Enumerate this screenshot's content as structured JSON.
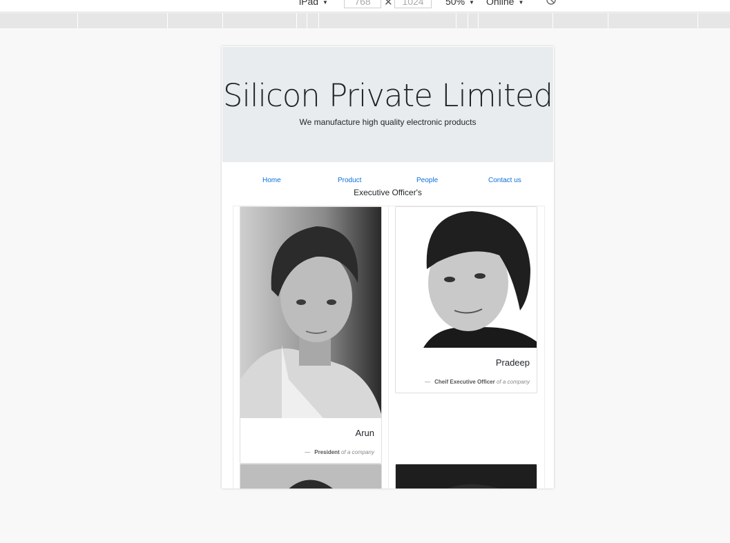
{
  "devtools": {
    "device": "iPad",
    "width": "768",
    "height": "1024",
    "zoom": "50%",
    "network": "Online"
  },
  "site": {
    "title": "Silicon Private Limited",
    "subtitle": "We manufacture high quality electronic products"
  },
  "nav": {
    "items": [
      "Home",
      "Product",
      "People",
      "Contact us"
    ]
  },
  "section": {
    "title": "Executive Officer's"
  },
  "cards": [
    {
      "name": "Arun",
      "role": "President",
      "org": "of a company"
    },
    {
      "name": "Pradeep",
      "role": "Cheif Executive Officer",
      "org": "of a company"
    }
  ],
  "colors": {
    "link": "#0b6fd8",
    "jumbotron": "#e9ecef"
  }
}
